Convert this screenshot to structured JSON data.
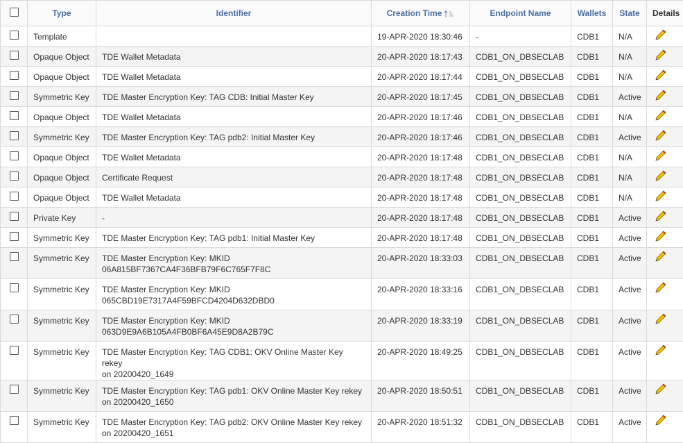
{
  "table": {
    "columns": {
      "type": "Type",
      "identifier": "Identifier",
      "creation_time": "Creation Time",
      "endpoint_name": "Endpoint Name",
      "wallets": "Wallets",
      "state": "State",
      "details": "Details"
    },
    "sort_icon": "sort-ascending-icon",
    "details_icon": "pencil-edit-icon",
    "rows": [
      {
        "type": "Template",
        "identifier": "",
        "identifier_2": "",
        "creation_time": "19-APR-2020 18:30:46",
        "endpoint_name": "-",
        "wallets": "CDB1",
        "state": "N/A"
      },
      {
        "type": "Opaque Object",
        "identifier": "TDE Wallet Metadata",
        "identifier_2": "",
        "creation_time": "20-APR-2020 18:17:43",
        "endpoint_name": "CDB1_ON_DBSECLAB",
        "wallets": "CDB1",
        "state": "N/A"
      },
      {
        "type": "Opaque Object",
        "identifier": "TDE Wallet Metadata",
        "identifier_2": "",
        "creation_time": "20-APR-2020 18:17:44",
        "endpoint_name": "CDB1_ON_DBSECLAB",
        "wallets": "CDB1",
        "state": "N/A"
      },
      {
        "type": "Symmetric Key",
        "identifier": "TDE Master Encryption Key: TAG CDB: Initial Master Key",
        "identifier_2": "",
        "creation_time": "20-APR-2020 18:17:45",
        "endpoint_name": "CDB1_ON_DBSECLAB",
        "wallets": "CDB1",
        "state": "Active"
      },
      {
        "type": "Opaque Object",
        "identifier": "TDE Wallet Metadata",
        "identifier_2": "",
        "creation_time": "20-APR-2020 18:17:46",
        "endpoint_name": "CDB1_ON_DBSECLAB",
        "wallets": "CDB1",
        "state": "N/A"
      },
      {
        "type": "Symmetric Key",
        "identifier": "TDE Master Encryption Key: TAG pdb2: Initial Master Key",
        "identifier_2": "",
        "creation_time": "20-APR-2020 18:17:46",
        "endpoint_name": "CDB1_ON_DBSECLAB",
        "wallets": "CDB1",
        "state": "Active"
      },
      {
        "type": "Opaque Object",
        "identifier": "TDE Wallet Metadata",
        "identifier_2": "",
        "creation_time": "20-APR-2020 18:17:48",
        "endpoint_name": "CDB1_ON_DBSECLAB",
        "wallets": "CDB1",
        "state": "N/A"
      },
      {
        "type": "Opaque Object",
        "identifier": "Certificate Request",
        "identifier_2": "",
        "creation_time": "20-APR-2020 18:17:48",
        "endpoint_name": "CDB1_ON_DBSECLAB",
        "wallets": "CDB1",
        "state": "N/A"
      },
      {
        "type": "Opaque Object",
        "identifier": "TDE Wallet Metadata",
        "identifier_2": "",
        "creation_time": "20-APR-2020 18:17:48",
        "endpoint_name": "CDB1_ON_DBSECLAB",
        "wallets": "CDB1",
        "state": "N/A"
      },
      {
        "type": "Private Key",
        "identifier": "-",
        "identifier_2": "",
        "creation_time": "20-APR-2020 18:17:48",
        "endpoint_name": "CDB1_ON_DBSECLAB",
        "wallets": "CDB1",
        "state": "Active"
      },
      {
        "type": "Symmetric Key",
        "identifier": "TDE Master Encryption Key: TAG pdb1: Initial Master Key",
        "identifier_2": "",
        "creation_time": "20-APR-2020 18:17:48",
        "endpoint_name": "CDB1_ON_DBSECLAB",
        "wallets": "CDB1",
        "state": "Active"
      },
      {
        "type": "Symmetric Key",
        "identifier": "TDE Master Encryption Key: MKID",
        "identifier_2": "06A815BF7367CA4F36BFB79F6C765F7F8C",
        "creation_time": "20-APR-2020 18:33:03",
        "endpoint_name": "CDB1_ON_DBSECLAB",
        "wallets": "CDB1",
        "state": "Active"
      },
      {
        "type": "Symmetric Key",
        "identifier": "TDE Master Encryption Key: MKID",
        "identifier_2": "065CBD19E7317A4F59BFCD4204D632DBD0",
        "creation_time": "20-APR-2020 18:33:16",
        "endpoint_name": "CDB1_ON_DBSECLAB",
        "wallets": "CDB1",
        "state": "Active"
      },
      {
        "type": "Symmetric Key",
        "identifier": "TDE Master Encryption Key: MKID",
        "identifier_2": "063D9E9A6B105A4FB0BF6A45E9D8A2B79C",
        "creation_time": "20-APR-2020 18:33:19",
        "endpoint_name": "CDB1_ON_DBSECLAB",
        "wallets": "CDB1",
        "state": "Active"
      },
      {
        "type": "Symmetric Key",
        "identifier": "TDE Master Encryption Key: TAG CDB1: OKV Online Master Key rekey",
        "identifier_2": "on 20200420_1649",
        "creation_time": "20-APR-2020 18:49:25",
        "endpoint_name": "CDB1_ON_DBSECLAB",
        "wallets": "CDB1",
        "state": "Active"
      },
      {
        "type": "Symmetric Key",
        "identifier": "TDE Master Encryption Key: TAG pdb1: OKV Online Master Key rekey",
        "identifier_2": "on 20200420_1650",
        "creation_time": "20-APR-2020 18:50:51",
        "endpoint_name": "CDB1_ON_DBSECLAB",
        "wallets": "CDB1",
        "state": "Active"
      },
      {
        "type": "Symmetric Key",
        "identifier": "TDE Master Encryption Key: TAG pdb2: OKV Online Master Key rekey",
        "identifier_2": "on 20200420_1651",
        "creation_time": "20-APR-2020 18:51:32",
        "endpoint_name": "CDB1_ON_DBSECLAB",
        "wallets": "CDB1",
        "state": "Active"
      }
    ]
  }
}
